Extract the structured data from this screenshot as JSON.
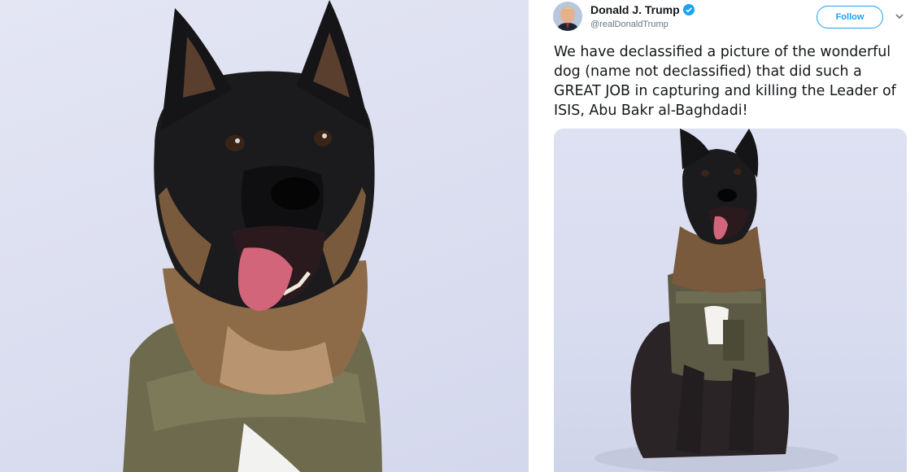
{
  "tweet": {
    "author_name": "Donald J. Trump",
    "handle": "@realDonaldTrump",
    "follow_label": "Follow",
    "text": "We have declassified a picture of the wonderful dog (name not declassified) that did such a GREAT JOB in capturing and killing the Leader of ISIS, Abu Bakr al-Baghdadi!",
    "accent_color": "#1da1f2"
  },
  "icons": {
    "verified": "verified-badge-icon",
    "menu": "chevron-down-icon"
  },
  "images": {
    "left": "dog-portrait-closeup",
    "media": "dog-sitting-full-body"
  }
}
